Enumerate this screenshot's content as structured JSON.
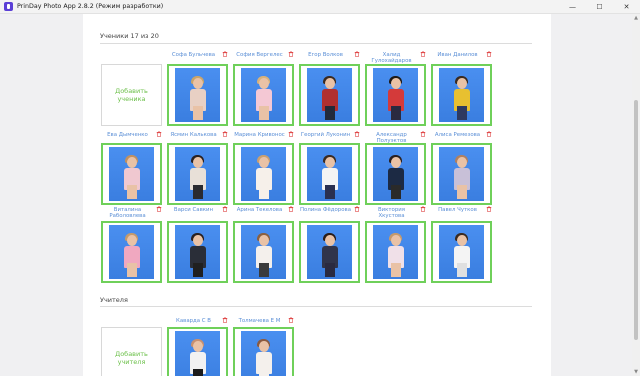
{
  "window": {
    "title": "PrinDay Photo App 2.8.2 (Режим разработки)",
    "minimize_glyph": "—",
    "maximize_glyph": "☐",
    "close_glyph": "✕"
  },
  "students_section": {
    "title": "Ученики 17 из 20",
    "add_label": "Добавить ученика"
  },
  "teachers_section": {
    "title": "Учителя",
    "add_label": "Добавить учителя"
  },
  "students": [
    {
      "name": "Софа Бульчева",
      "hair": "#c9a46a",
      "outfit": "#e8d0c4",
      "legs": "#e9c2a6"
    },
    {
      "name": "София Вергелес",
      "hair": "#d8b27a",
      "outfit": "#f4c8d4",
      "legs": "#e9c2a6"
    },
    {
      "name": "Егор Волков",
      "hair": "#3b2a20",
      "outfit": "#b03030",
      "legs": "#222a3a"
    },
    {
      "name": "Халид Гулохайдаров",
      "hair": "#1e1a18",
      "outfit": "#d43a3a",
      "legs": "#2a2a40"
    },
    {
      "name": "Иван Данилов",
      "hair": "#3a2a20",
      "outfit": "#e8c030",
      "legs": "#2e3a60"
    },
    {
      "name": "Ева Дымченко",
      "hair": "#c09060",
      "outfit": "#f0c8d0",
      "legs": "#e9c2a6"
    },
    {
      "name": "Ясмин Калькова",
      "hair": "#2a2020",
      "outfit": "#e8e0d8",
      "legs": "#2a2a30"
    },
    {
      "name": "Марина Кривонос",
      "hair": "#caa070",
      "outfit": "#f6f0ea",
      "legs": "#f6f0ea"
    },
    {
      "name": "Георгий Луконин",
      "hair": "#3a2a22",
      "outfit": "#f4f4f4",
      "legs": "#2a3050"
    },
    {
      "name": "Александр Полуэктов",
      "hair": "#2a2020",
      "outfit": "#1c2a44",
      "legs": "#2a2a2a"
    },
    {
      "name": "Алиса Ремезова",
      "hair": "#b08060",
      "outfit": "#c8c0d8",
      "legs": "#e9c2a6"
    },
    {
      "name": "Виталина Раболовлева",
      "hair": "#c49a6c",
      "outfit": "#f0a8c0",
      "legs": "#e9c2a6"
    },
    {
      "name": "Варси Савкин",
      "hair": "#2a2020",
      "outfit": "#2a2e38",
      "legs": "#202020"
    },
    {
      "name": "Арина Текелова",
      "hair": "#8a6040",
      "outfit": "#f4f0ec",
      "legs": "#3a3a3a"
    },
    {
      "name": "Полина Фёдорова",
      "hair": "#2a1c18",
      "outfit": "#30344a",
      "legs": "#2a2a40"
    },
    {
      "name": "Виктория Хкустова",
      "hair": "#c49a6c",
      "outfit": "#f0e0e8",
      "legs": "#e9c2a6"
    },
    {
      "name": "Павел Чутков",
      "hair": "#3a2a20",
      "outfit": "#f4f4f4",
      "legs": "#e0e0e0"
    }
  ],
  "teachers": [
    {
      "name": "Каварда С В",
      "hair": "#c89070",
      "outfit": "#f2f2f2",
      "legs": "#1c1c1c"
    },
    {
      "name": "Толмачева Е М",
      "hair": "#8a5a40",
      "outfit": "#f4f0ec",
      "legs": "#f4f0ec"
    }
  ],
  "colors": {
    "accent_green": "#6fd05a",
    "name_blue": "#5b8fd6",
    "trash_red": "#e04a4a",
    "photo_bg": "#3f86ea"
  }
}
